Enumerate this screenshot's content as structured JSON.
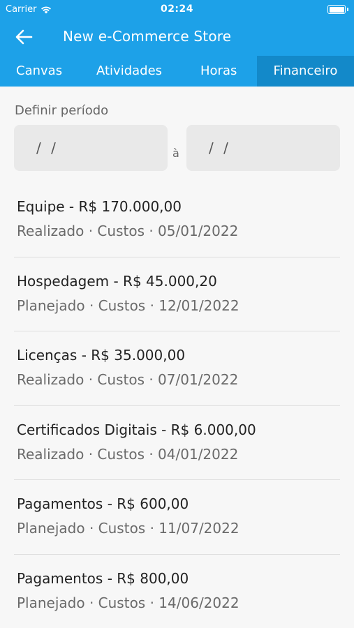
{
  "status_bar": {
    "carrier": "Carrier",
    "time": "02:24"
  },
  "nav": {
    "title": "New e-Commerce Store",
    "back_icon": "arrow-left-icon"
  },
  "tabs": [
    {
      "label": "Canvas",
      "active": false
    },
    {
      "label": "Atividades",
      "active": false
    },
    {
      "label": "Horas",
      "active": false
    },
    {
      "label": "Financeiro",
      "active": true
    }
  ],
  "period": {
    "label": "Definir período",
    "start_value": "/ /",
    "separator": "à",
    "end_value": "/ /"
  },
  "entries": [
    {
      "title": "Equipe - R$  170.000,00",
      "subtitle": "Realizado · Custos · 05/01/2022"
    },
    {
      "title": "Hospedagem - R$  45.000,20",
      "subtitle": "Planejado · Custos · 12/01/2022"
    },
    {
      "title": "Licenças - R$  35.000,00",
      "subtitle": "Realizado · Custos · 07/01/2022"
    },
    {
      "title": "Certificados Digitais - R$  6.000,00",
      "subtitle": "Realizado · Custos · 04/01/2022"
    },
    {
      "title": "Pagamentos - R$  600,00",
      "subtitle": "Planejado · Custos · 11/07/2022"
    },
    {
      "title": "Pagamentos - R$  800,00",
      "subtitle": "Planejado · Custos · 14/06/2022"
    }
  ],
  "colors": {
    "header": "#1da1e8",
    "active_tab": "#1389c9",
    "background": "#f7f7f7",
    "input_background": "#e9e9e9"
  }
}
